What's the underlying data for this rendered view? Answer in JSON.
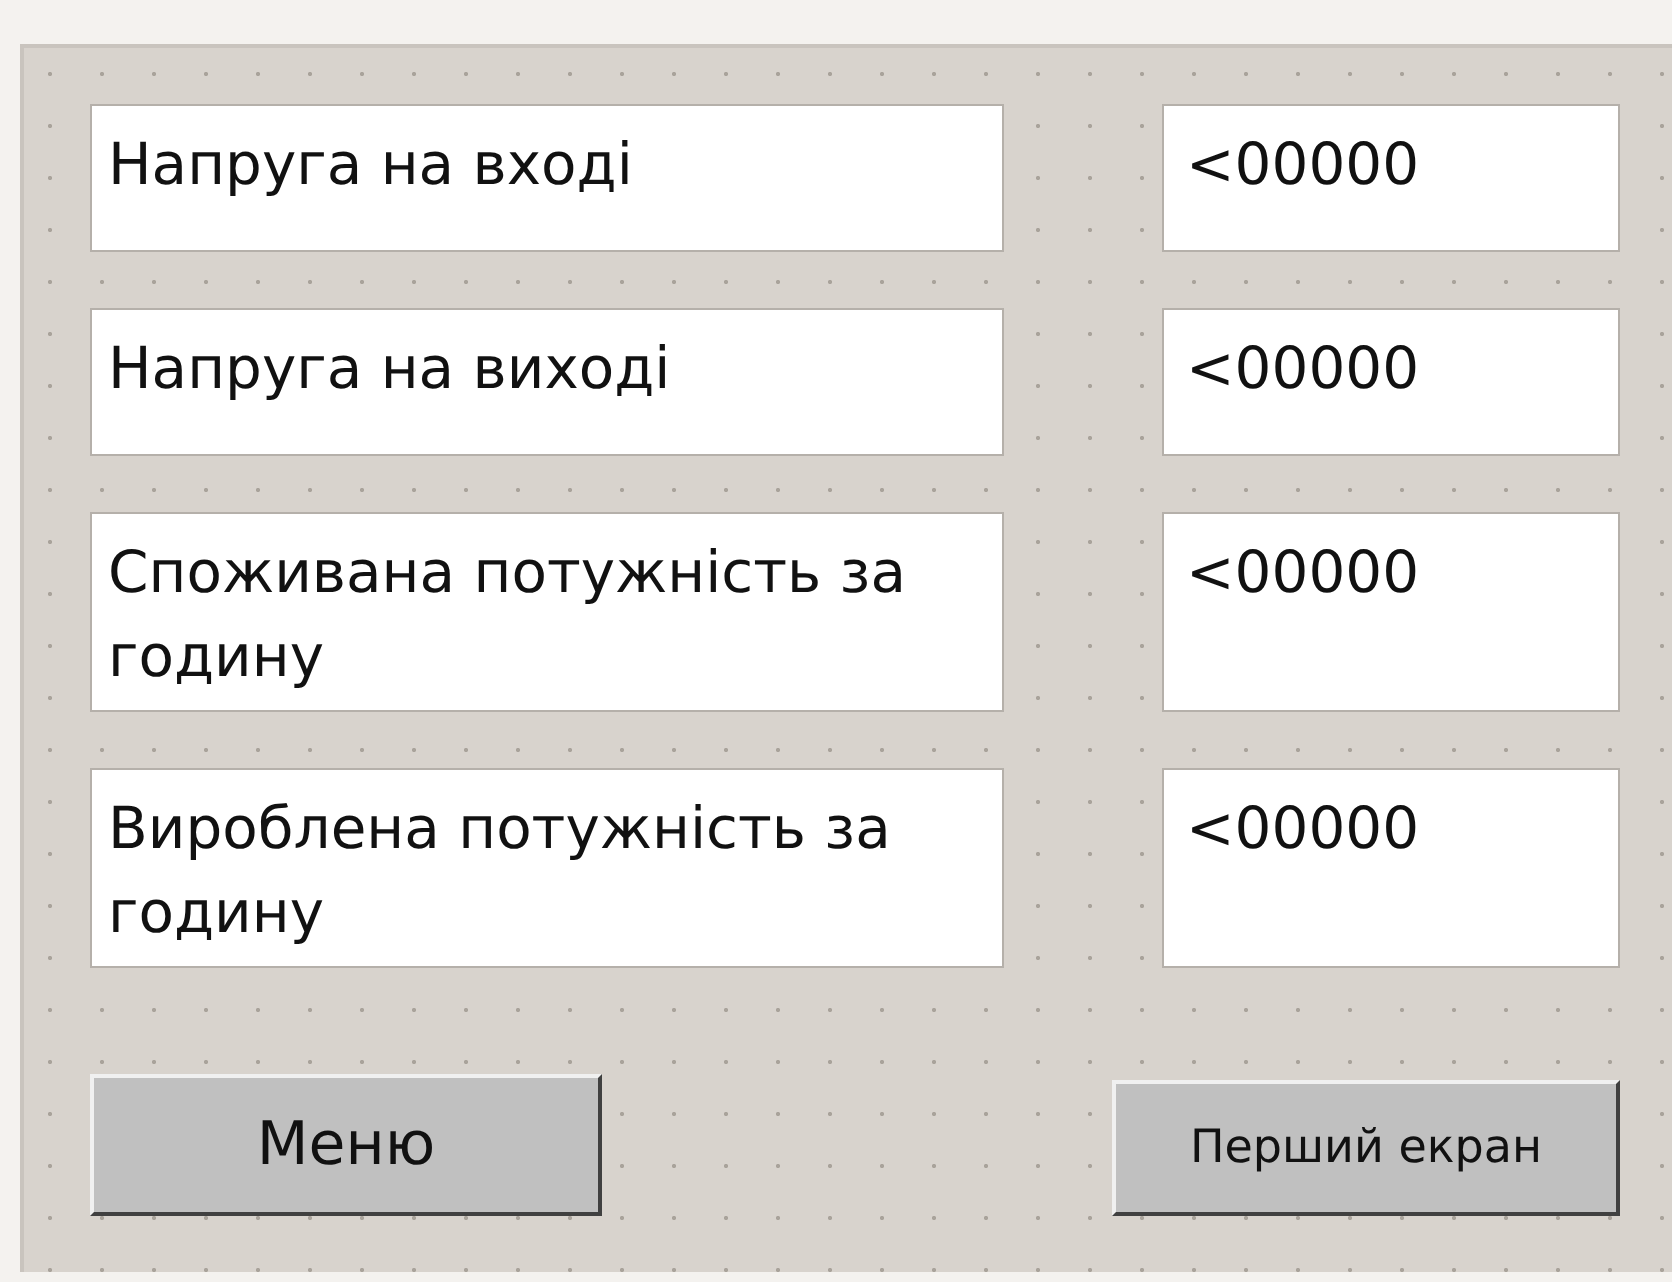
{
  "rows": [
    {
      "label": "Напруга на вході",
      "value": "<00000"
    },
    {
      "label": "Напруга на виході",
      "value": "<00000"
    },
    {
      "label": "Споживана потужність за годину",
      "value": "<00000"
    },
    {
      "label": "Вироблена потужність за годину",
      "value": "<00000"
    }
  ],
  "buttons": [
    {
      "label": "Меню",
      "kind": "large"
    },
    {
      "label": "Перший екран",
      "kind": "small"
    }
  ]
}
